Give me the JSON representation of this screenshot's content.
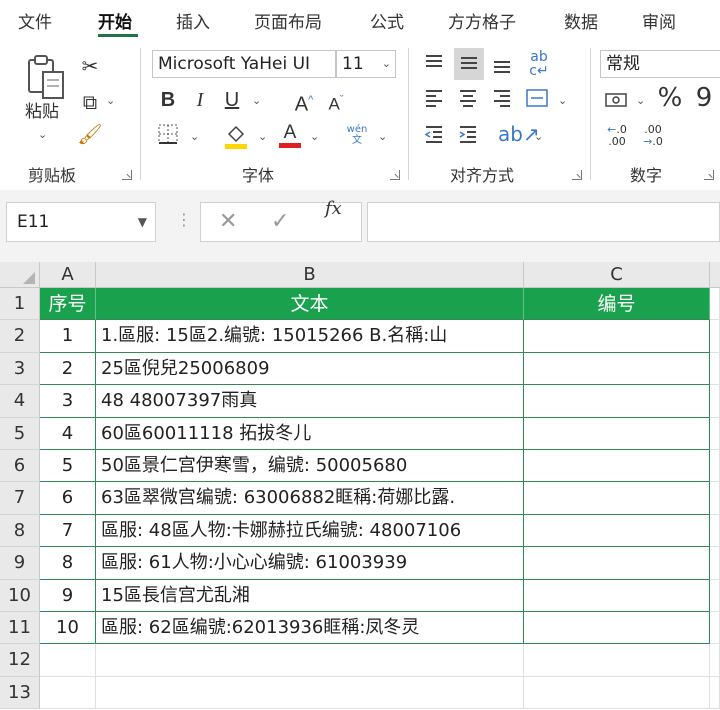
{
  "menu": {
    "tabs": [
      "文件",
      "开始",
      "插入",
      "页面布局",
      "公式",
      "方方格子",
      "数据",
      "审阅"
    ]
  },
  "ribbon": {
    "clipboard": {
      "label": "剪贴板",
      "paste_label": "粘贴"
    },
    "font": {
      "label": "字体",
      "font_name": "Microsoft YaHei UI",
      "font_size": "11",
      "pinyin_label": "wén\n文"
    },
    "alignment": {
      "label": "对齐方式"
    },
    "number": {
      "label": "数字",
      "format": "常规"
    },
    "colors": {
      "accent": "#217346",
      "highlight": "#ffd600",
      "font_color": "#e02020",
      "table_header": "#1aa14d"
    }
  },
  "formula_bar": {
    "name_box": "E11",
    "formula": ""
  },
  "sheet": {
    "columns": [
      "A",
      "B",
      "C"
    ],
    "rows": [
      "1",
      "2",
      "3",
      "4",
      "5",
      "6",
      "7",
      "8",
      "9",
      "10",
      "11",
      "12",
      "13"
    ],
    "header": {
      "seq": "序号",
      "text": "文本",
      "code": "编号"
    },
    "data": [
      {
        "seq": "1",
        "text": "1.區服: 15區2.编號: 15015266 B.名稱:山",
        "code": ""
      },
      {
        "seq": "2",
        "text": "25區倪兒25006809",
        "code": ""
      },
      {
        "seq": "3",
        "text": "48 48007397雨真",
        "code": ""
      },
      {
        "seq": "4",
        "text": "60區60011118 拓拔冬儿",
        "code": ""
      },
      {
        "seq": "5",
        "text": "50區景仁宫伊寒雪，编號: 50005680",
        "code": ""
      },
      {
        "seq": "6",
        "text": "63區翠微宫编號: 63006882眶稱:荷娜比露.",
        "code": ""
      },
      {
        "seq": "7",
        "text": "區服: 48區人物:卡娜赫拉氏编號: 48007106",
        "code": ""
      },
      {
        "seq": "8",
        "text": "區服: 61人物:小心心编號: 61003939",
        "code": ""
      },
      {
        "seq": "9",
        "text": "15區長信宫尤乱湘",
        "code": ""
      },
      {
        "seq": "10",
        "text": "區服: 62區编號:62013936眶稱:凤冬灵",
        "code": ""
      }
    ]
  }
}
